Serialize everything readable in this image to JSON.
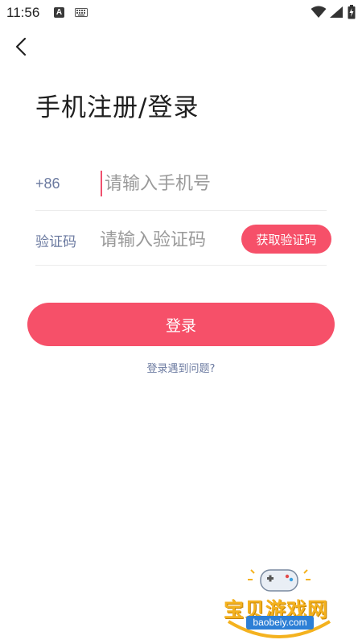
{
  "status_bar": {
    "time": "11:56",
    "app_indicator": "A"
  },
  "header": {
    "back_icon": "chevron-left-icon",
    "title": "手机注册/登录"
  },
  "phone_field": {
    "country_code": "+86",
    "placeholder": "请输入手机号",
    "value": ""
  },
  "code_field": {
    "label": "验证码",
    "placeholder": "请输入验证码",
    "value": "",
    "get_code_label": "获取验证码"
  },
  "login_button_label": "登录",
  "help_link": "登录遇到问题?",
  "watermark": {
    "title": "宝贝游戏网",
    "url": "baobeiy.com"
  },
  "colors": {
    "accent": "#f65069",
    "label": "#6b7aa0",
    "placeholder": "#9a9a9a"
  }
}
